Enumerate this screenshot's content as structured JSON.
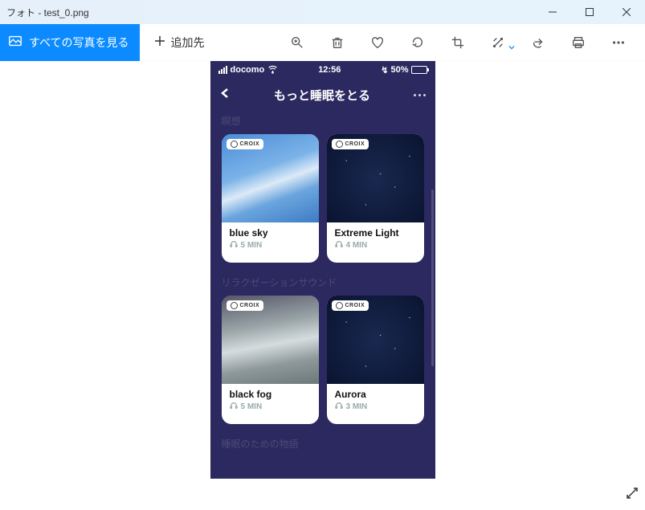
{
  "window": {
    "title": "フォト - test_0.png"
  },
  "toolbar": {
    "view_all": "すべての写真を見る",
    "add_to": "追加先"
  },
  "phone": {
    "status": {
      "carrier": "docomo",
      "time": "12:56",
      "battery_pct": "50%",
      "charging_glyph": "↯"
    },
    "nav": {
      "title": "もっと睡眠をとる"
    },
    "sections": {
      "sec1": "瞑想",
      "sec2": "リラクゼーションサウンド",
      "sec3": "睡眠のための物語"
    },
    "badge": "CROIX",
    "cards": [
      {
        "title": "blue sky",
        "duration": "5 MIN"
      },
      {
        "title": "Extreme Light",
        "duration": "4 MIN"
      },
      {
        "title": "black fog",
        "duration": "5 MIN"
      },
      {
        "title": "Aurora",
        "duration": "3 MIN"
      }
    ]
  }
}
